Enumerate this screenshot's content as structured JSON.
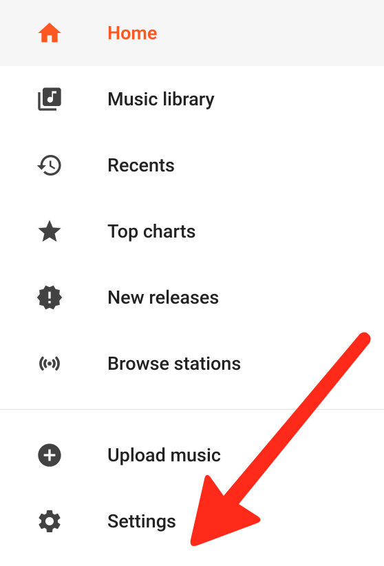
{
  "nav": {
    "main": [
      {
        "id": "home",
        "label": "Home",
        "icon": "home-icon",
        "active": true
      },
      {
        "id": "music-library",
        "label": "Music library",
        "icon": "music-library-icon",
        "active": false
      },
      {
        "id": "recents",
        "label": "Recents",
        "icon": "recents-icon",
        "active": false
      },
      {
        "id": "top-charts",
        "label": "Top charts",
        "icon": "star-icon",
        "active": false
      },
      {
        "id": "new-releases",
        "label": "New releases",
        "icon": "new-releases-icon",
        "active": false
      },
      {
        "id": "browse-stations",
        "label": "Browse stations",
        "icon": "radio-icon",
        "active": false
      }
    ],
    "secondary": [
      {
        "id": "upload-music",
        "label": "Upload music",
        "icon": "add-circle-icon"
      },
      {
        "id": "settings",
        "label": "Settings",
        "icon": "gear-icon"
      }
    ]
  },
  "colors": {
    "accent": "#ff5722",
    "icon": "#424242",
    "text": "#212121",
    "activeBg": "#f5f5f5",
    "arrow": "#ff2a1a"
  },
  "annotation": {
    "type": "arrow",
    "target": "settings"
  }
}
